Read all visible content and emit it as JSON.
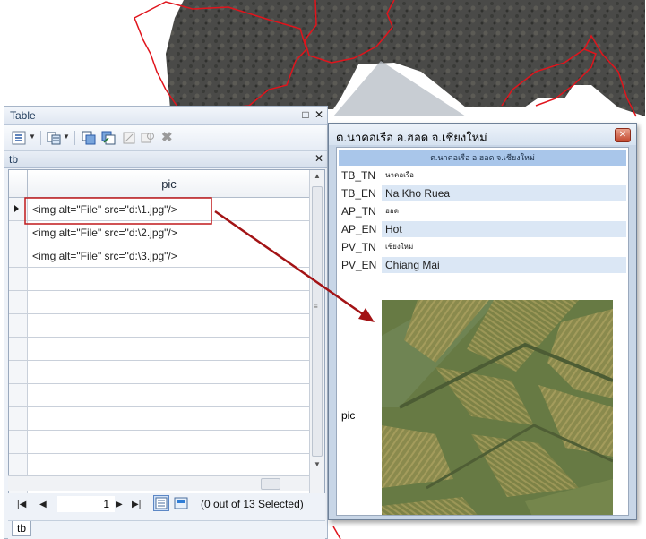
{
  "table_window": {
    "title": "Table",
    "controls": {
      "pin": "□",
      "close": "✕"
    },
    "tab_header": "tb",
    "tab_close": "✕",
    "column_header": "pic",
    "rows": [
      "<img alt=\"File\" src=\"d:\\1.jpg\"/>",
      "<img alt=\"File\" src=\"d:\\2.jpg\"/>",
      "<img alt=\"File\" src=\"d:\\3.jpg\"/>"
    ],
    "navigation": {
      "first": "|◀",
      "prev": "◀",
      "page": "1",
      "next": "▶",
      "last": "▶|",
      "selection_status": "(0 out of 13 Selected)"
    },
    "bottom_tab": "tb"
  },
  "popup_window": {
    "title": "ต.นาคอเรือ อ.ฮอด จ.เชียงใหม่",
    "close": "✕",
    "header": "ต.นาคอเรือ อ.ฮอด จ.เชียงใหม่",
    "fields": [
      {
        "key": "TB_TN",
        "value": "นาคอเรือ"
      },
      {
        "key": "TB_EN",
        "value": "Na Kho Ruea"
      },
      {
        "key": "AP_TN",
        "value": "ฮอด"
      },
      {
        "key": "AP_EN",
        "value": "Hot"
      },
      {
        "key": "PV_TN",
        "value": "เชียงใหม่"
      },
      {
        "key": "PV_EN",
        "value": "Chiang Mai"
      }
    ],
    "pic_label": "pic"
  },
  "colors": {
    "highlight_box": "#c0181b",
    "arrow": "#a31315",
    "boundary": "#e0141c",
    "popup_header": "#a9c6ea"
  }
}
